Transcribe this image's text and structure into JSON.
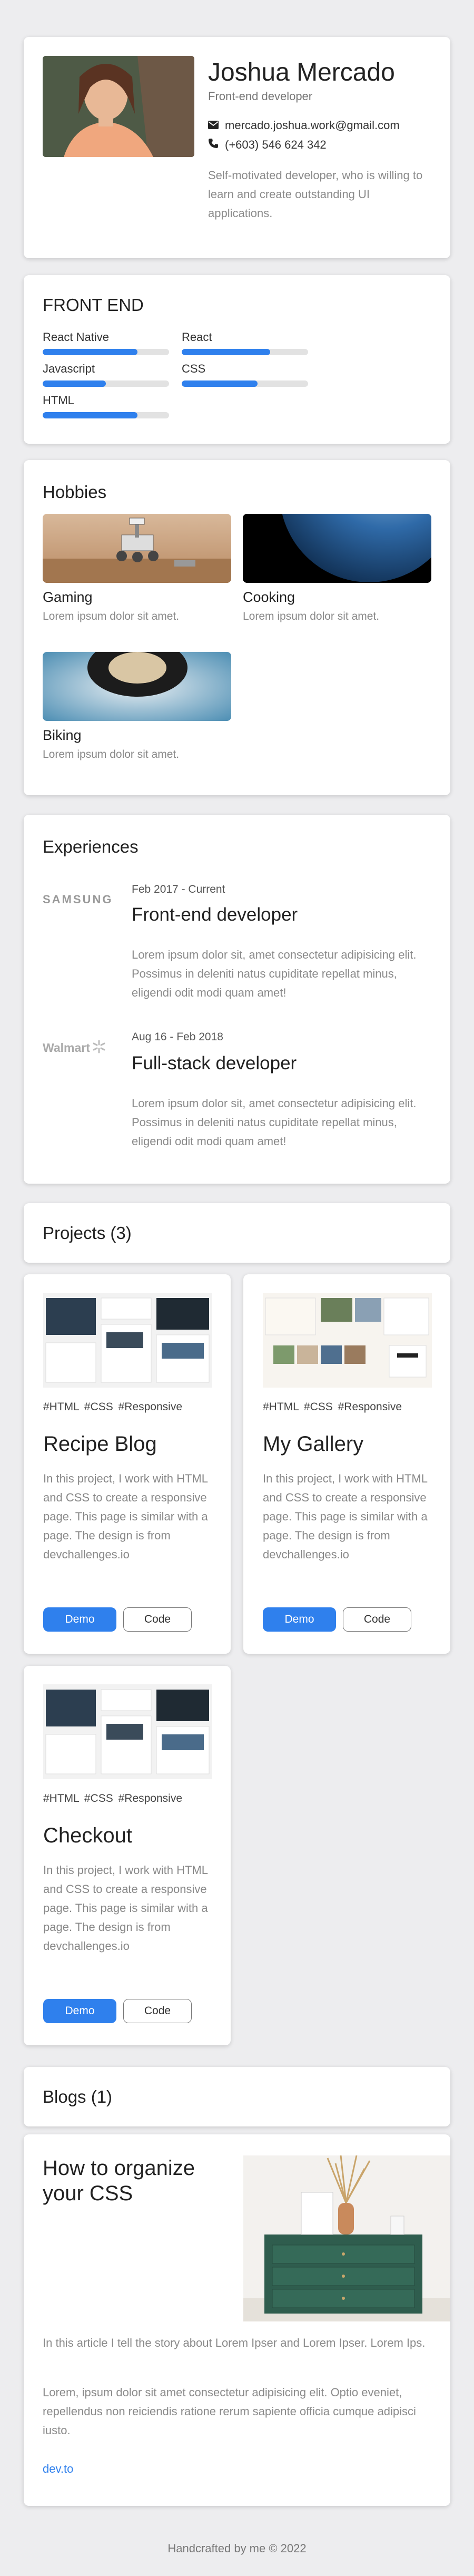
{
  "profile": {
    "name": "Joshua Mercado",
    "role": "Front-end developer",
    "email": "mercado.joshua.work@gmail.com",
    "phone": "(+603) 546 624 342",
    "bio": "Self-motivated developer, who is willing to learn and create outstanding UI applications."
  },
  "frontend": {
    "title": "FRONT END",
    "skills": [
      {
        "label": "React Native",
        "level": 0.75
      },
      {
        "label": "React",
        "level": 0.7
      },
      {
        "label": "Javascript",
        "level": 0.5
      },
      {
        "label": "CSS",
        "level": 0.6
      },
      {
        "label": "HTML",
        "level": 0.75
      }
    ]
  },
  "hobbies": {
    "title": "Hobbies",
    "items": [
      {
        "title": "Gaming",
        "desc": "Lorem ipsum dolor sit amet."
      },
      {
        "title": "Cooking",
        "desc": "Lorem ipsum dolor sit amet."
      },
      {
        "title": "Biking",
        "desc": "Lorem ipsum dolor sit amet."
      }
    ]
  },
  "experiences": {
    "title": "Experiences",
    "items": [
      {
        "company": "SAMSUNG",
        "date": "Feb 2017 - Current",
        "title": "Front-end developer",
        "desc": "Lorem ipsum dolor sit, amet consectetur adipisicing elit. Possimus in deleniti natus cupiditate repellat minus, eligendi odit modi quam amet!"
      },
      {
        "company": "Walmart",
        "date": "Aug 16 - Feb 2018",
        "title": "Full-stack developer",
        "desc": "Lorem ipsum dolor sit, amet consectetur adipisicing elit. Possimus in deleniti natus cupiditate repellat minus, eligendi odit modi quam amet!"
      }
    ]
  },
  "projects": {
    "title": "Projects (3)",
    "items": [
      {
        "tags": "#HTML #CSS #Responsive",
        "title": "Recipe Blog",
        "desc": "In this project, I work with HTML and CSS to create a responsive page. This page is similar with a page. The design is from devchallenges.io",
        "demo": "Demo",
        "code": "Code"
      },
      {
        "tags": "#HTML #CSS #Responsive",
        "title": "My Gallery",
        "desc": "In this project, I work with HTML and CSS to create a responsive page. This page is similar with a page. The design is from devchallenges.io",
        "demo": "Demo",
        "code": "Code"
      },
      {
        "tags": "#HTML #CSS #Responsive",
        "title": "Checkout",
        "desc": "In this project, I work with HTML and CSS to create a responsive page. This page is similar with a page. The design is from devchallenges.io",
        "demo": "Demo",
        "code": "Code"
      }
    ]
  },
  "blogs": {
    "title": "Blogs (1)",
    "post": {
      "title": "How to organize your CSS",
      "intro": "In this article I tell the story about Lorem Ipser and Lorem Ipser. Lorem Ips.",
      "body": "Lorem, ipsum dolor sit amet consectetur adipisicing elit. Optio eveniet, repellendus non reiciendis ratione rerum sapiente officia cumque adipisci iusto.",
      "link": "dev.to"
    }
  },
  "footer": {
    "text": "Handcrafted by me © 2022"
  },
  "colors": {
    "accent": "#2f80ed",
    "background": "#ededef"
  }
}
